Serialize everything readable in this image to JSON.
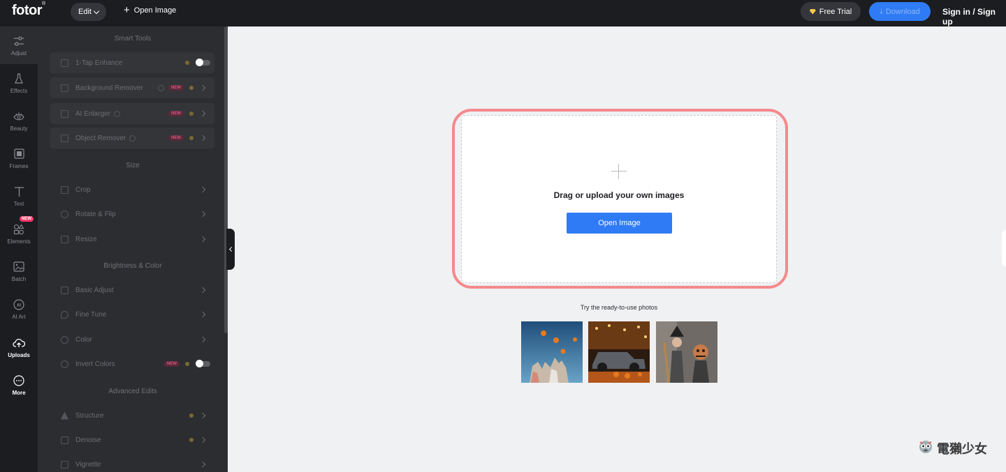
{
  "app": {
    "logo": "fotor"
  },
  "topbar": {
    "edit_label": "Edit",
    "open_image_label": "Open Image",
    "free_trial_label": "Free Trial",
    "download_label": "Download",
    "signin_label": "Sign in / Sign up"
  },
  "rail": {
    "items": [
      {
        "label": "Adjust",
        "icon": "sliders-icon"
      },
      {
        "label": "Effects",
        "icon": "flask-icon"
      },
      {
        "label": "Beauty",
        "icon": "eye-icon"
      },
      {
        "label": "Frames",
        "icon": "frame-icon"
      },
      {
        "label": "Text",
        "icon": "text-icon"
      },
      {
        "label": "Elements",
        "icon": "shapes-icon",
        "badge": "NEW"
      },
      {
        "label": "Batch",
        "icon": "images-icon"
      },
      {
        "label": "AI Art",
        "icon": "ai-icon"
      },
      {
        "label": "Uploads",
        "icon": "cloud-upload-icon"
      },
      {
        "label": "More",
        "icon": "more-icon"
      }
    ]
  },
  "panel": {
    "sections": {
      "smart_tools": "Smart Tools",
      "size": "Size",
      "brightness_color": "Brightness & Color",
      "advanced_edits": "Advanced Edits"
    },
    "tools": {
      "one_tap": "1-Tap Enhance",
      "background_remover": "Background Remover",
      "ai_enlarger": "AI Enlarger",
      "object_remover": "Object Remover",
      "crop": "Crop",
      "rotate_flip": "Rotate & Flip",
      "resize": "Resize",
      "basic_adjust": "Basic Adjust",
      "fine_tune": "Fine Tune",
      "color": "Color",
      "invert_colors": "Invert Colors",
      "structure": "Structure",
      "denoise": "Denoise",
      "vignette": "Vignette"
    },
    "new_tag": "NEW"
  },
  "upload": {
    "drag_text": "Drag or upload your own images",
    "open_button": "Open Image",
    "try_label": "Try the ready-to-use photos"
  },
  "watermark": {
    "text": "電獺少女"
  },
  "colors": {
    "accent": "#2f7bf5",
    "highlight_outline": "#f4898c",
    "panel_bg": "#2c2d31",
    "topbar_bg": "#1c1d21"
  }
}
